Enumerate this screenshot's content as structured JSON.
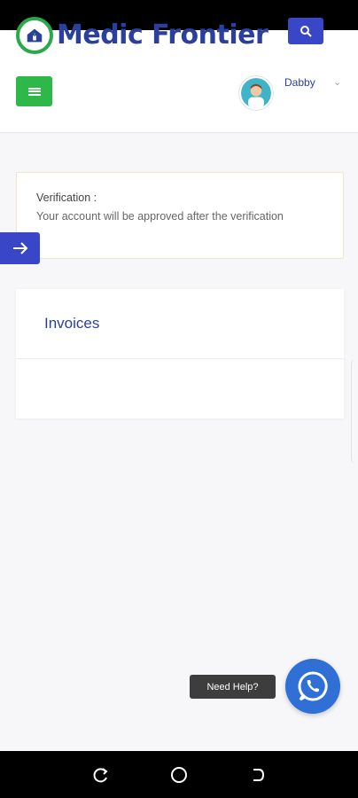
{
  "app": {
    "logo_text": "Medic Frontier",
    "accent": "#3a46c8",
    "brand_green": "#2fb84a"
  },
  "header": {
    "search_icon": "search-icon",
    "menu_icon": "hamburger-icon",
    "user": {
      "name": "Dabby",
      "caret_icon": "chevron-down-icon"
    }
  },
  "verification": {
    "title": "Verification :",
    "message": "Your account will be approved after the verification"
  },
  "invoices": {
    "title": "Invoices"
  },
  "help": {
    "label": "Need Help?",
    "icon": "whatsapp-icon"
  },
  "system_nav": {
    "icons": [
      "recent-apps-icon",
      "home-icon",
      "back-icon"
    ]
  }
}
